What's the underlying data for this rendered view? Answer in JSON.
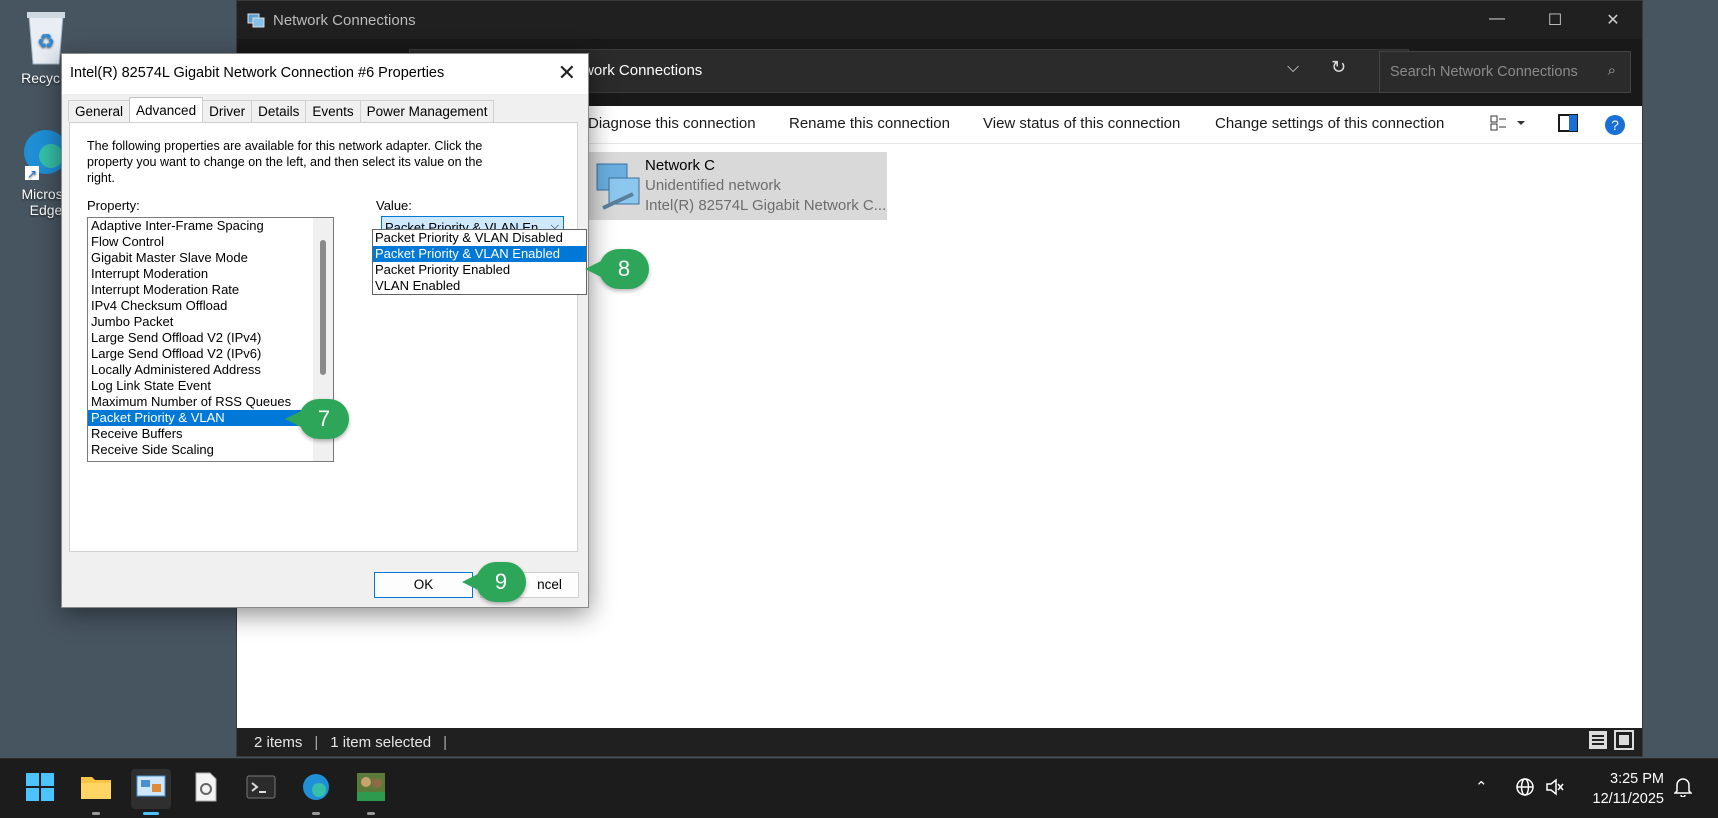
{
  "desktop": {
    "recycle_bin_label": "Recycle",
    "edge_label_1": "Microso",
    "edge_label_2": "Edge"
  },
  "explorer": {
    "title": "Network Connections",
    "breadcrumb": "etwork and Internet  ›  Network Connections",
    "search_placeholder": "Search Network Connections",
    "commands": {
      "diagnose": "Diagnose this connection",
      "rename": "Rename this connection",
      "view_status": "View status of this connection",
      "change_settings": "Change settings of this connection"
    },
    "item": {
      "name": "Network C",
      "status": "Unidentified network",
      "adapter": "Intel(R) 82574L Gigabit Network C..."
    },
    "status_bar": {
      "count": "2 items",
      "selected": "1 item selected"
    }
  },
  "dialog": {
    "title": "Intel(R) 82574L Gigabit Network Connection #6 Properties",
    "tabs": [
      "General",
      "Advanced",
      "Driver",
      "Details",
      "Events",
      "Power Management"
    ],
    "description": "The following properties are available for this network adapter. Click the property you want to change on the left, and then select its value on the right.",
    "property_label": "Property:",
    "value_label": "Value:",
    "properties": [
      "Adaptive Inter-Frame Spacing",
      "Flow Control",
      "Gigabit Master Slave Mode",
      "Interrupt Moderation",
      "Interrupt Moderation Rate",
      "IPv4 Checksum Offload",
      "Jumbo Packet",
      "Large Send Offload V2 (IPv4)",
      "Large Send Offload V2 (IPv6)",
      "Locally Administered Address",
      "Log Link State Event",
      "Maximum Number of RSS Queues",
      "Packet Priority & VLAN",
      "Receive Buffers",
      "Receive Side Scaling"
    ],
    "value_current": "Packet Priority & VLAN En",
    "value_options": [
      "Packet Priority & VLAN Disabled",
      "Packet Priority & VLAN Enabled",
      "Packet Priority Enabled",
      "VLAN Enabled"
    ],
    "ok_label": "OK",
    "cancel_label": "ncel"
  },
  "badges": {
    "step7": "7",
    "step8": "8",
    "step9": "9"
  },
  "taskbar": {
    "time": "3:25 PM",
    "date": "12/11/2025"
  },
  "colors": {
    "accent": "#0078d7",
    "badge": "#2da65a"
  }
}
